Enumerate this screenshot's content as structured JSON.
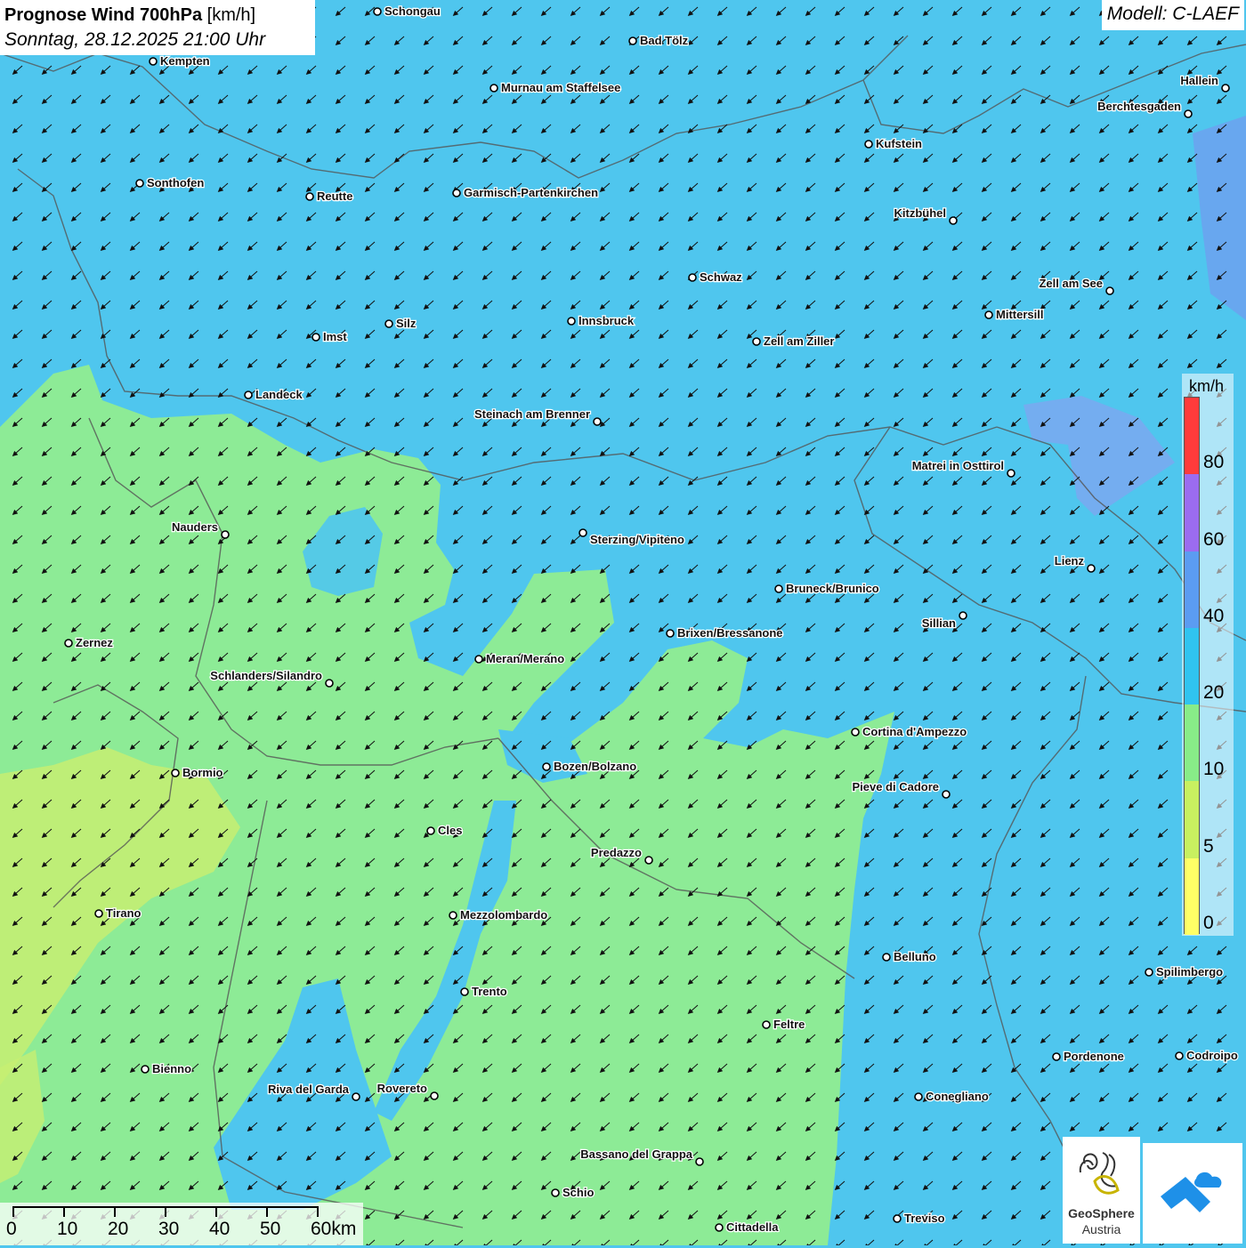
{
  "header": {
    "title_bold": "Prognose Wind 700hPa",
    "title_unit": "[km/h]",
    "subtitle": "Sonntag, 28.12.2025 21:00 Uhr"
  },
  "model": {
    "label": "Modell: C-LAEF"
  },
  "legend": {
    "unit": "km/h",
    "bins": [
      {
        "from": 0,
        "to": 5,
        "color": "#ffff66"
      },
      {
        "from": 5,
        "to": 10,
        "color": "#c8f060"
      },
      {
        "from": 10,
        "to": 20,
        "color": "#88ec88"
      },
      {
        "from": 20,
        "to": 40,
        "color": "#30c4f0"
      },
      {
        "from": 40,
        "to": 60,
        "color": "#5b9cf2"
      },
      {
        "from": 60,
        "to": 80,
        "color": "#9b6cf0"
      },
      {
        "from": 80,
        "to": 100,
        "color": "#ff3b3b"
      }
    ],
    "labels": [
      "0",
      "5",
      "10",
      "20",
      "40",
      "60",
      "80"
    ]
  },
  "scale_bar": {
    "labels": [
      "0",
      "10",
      "20",
      "30",
      "40",
      "50",
      "60km"
    ]
  },
  "logos": {
    "geosphere_line1": "GeoSphere",
    "geosphere_line2": "Austria"
  },
  "cities": [
    {
      "name": "Schongau"
    },
    {
      "name": "Bad Tölz"
    },
    {
      "name": "Kempten"
    },
    {
      "name": "Murnau am Staffelsee"
    },
    {
      "name": "Hallein"
    },
    {
      "name": "Berchtesgaden"
    },
    {
      "name": "Kufstein"
    },
    {
      "name": "Sonthofen"
    },
    {
      "name": "Reutte"
    },
    {
      "name": "Garmisch-Partenkirchen"
    },
    {
      "name": "Kitzbühel"
    },
    {
      "name": "Schwaz"
    },
    {
      "name": "Zell am See"
    },
    {
      "name": "Mittersill"
    },
    {
      "name": "Innsbruck"
    },
    {
      "name": "Silz"
    },
    {
      "name": "Imst"
    },
    {
      "name": "Zell am Ziller"
    },
    {
      "name": "Landeck"
    },
    {
      "name": "Steinach am Brenner"
    },
    {
      "name": "Matrei in Osttirol"
    },
    {
      "name": "Nauders"
    },
    {
      "name": "Sterzing/Vipiteno"
    },
    {
      "name": "Lienz"
    },
    {
      "name": "Bruneck/Brunico"
    },
    {
      "name": "Sillian"
    },
    {
      "name": "Brixen/Bressanone"
    },
    {
      "name": "Zernez"
    },
    {
      "name": "Meran/Merano"
    },
    {
      "name": "Schlanders/Silandro"
    },
    {
      "name": "Cortina d'Ampezzo"
    },
    {
      "name": "Bozen/Bolzano"
    },
    {
      "name": "Bormio"
    },
    {
      "name": "Pieve di Cadore"
    },
    {
      "name": "Cles"
    },
    {
      "name": "Predazzo"
    },
    {
      "name": "Tirano"
    },
    {
      "name": "Mezzolombardo"
    },
    {
      "name": "Belluno"
    },
    {
      "name": "Spilimbergo"
    },
    {
      "name": "Trento"
    },
    {
      "name": "Feltre"
    },
    {
      "name": "Pordenone"
    },
    {
      "name": "Codroipo"
    },
    {
      "name": "Bienno"
    },
    {
      "name": "Riva del Garda"
    },
    {
      "name": "Rovereto"
    },
    {
      "name": "Conegliano"
    },
    {
      "name": "Bassano del Grappa"
    },
    {
      "name": "Schio"
    },
    {
      "name": "Treviso"
    },
    {
      "name": "Cittadella"
    }
  ]
}
